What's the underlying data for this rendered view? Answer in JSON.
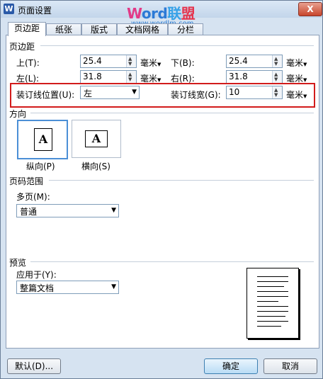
{
  "window": {
    "title": "页面设置",
    "close_label": "X",
    "app_icon": "W"
  },
  "watermark": {
    "brand_part1": "W",
    "brand_part2": "ord",
    "brand_part3": "联",
    "brand_part4": "盟",
    "url": "www.wordlm.com"
  },
  "tabs": [
    {
      "label": "页边距",
      "active": true
    },
    {
      "label": "纸张",
      "active": false
    },
    {
      "label": "版式",
      "active": false
    },
    {
      "label": "文档网格",
      "active": false
    },
    {
      "label": "分栏",
      "active": false
    }
  ],
  "margins": {
    "section_title": "页边距",
    "top": {
      "label": "上(T):",
      "value": "25.4",
      "unit": "毫米"
    },
    "bottom": {
      "label": "下(B):",
      "value": "25.4",
      "unit": "毫米"
    },
    "left": {
      "label": "左(L):",
      "value": "31.8",
      "unit": "毫米"
    },
    "right": {
      "label": "右(R):",
      "value": "31.8",
      "unit": "毫米"
    },
    "gutter_pos": {
      "label": "装订线位置(U):",
      "value": "左"
    },
    "gutter": {
      "label": "装订线宽(G):",
      "value": "10",
      "unit": "毫米"
    }
  },
  "orientation": {
    "section_title": "方向",
    "portrait_label": "纵向(P)",
    "landscape_label": "横向(S)",
    "glyph": "A",
    "selected": "portrait"
  },
  "pages": {
    "section_title": "页码范围",
    "multi_label": "多页(M):",
    "multi_value": "普通"
  },
  "preview": {
    "section_title": "预览",
    "apply_label": "应用于(Y):",
    "apply_value": "整篇文档"
  },
  "buttons": {
    "default": "默认(D)...",
    "ok": "确定",
    "cancel": "取消"
  },
  "colors": {
    "highlight_box": "#d21b1b",
    "selected_orientation": "#4b8fd6"
  }
}
